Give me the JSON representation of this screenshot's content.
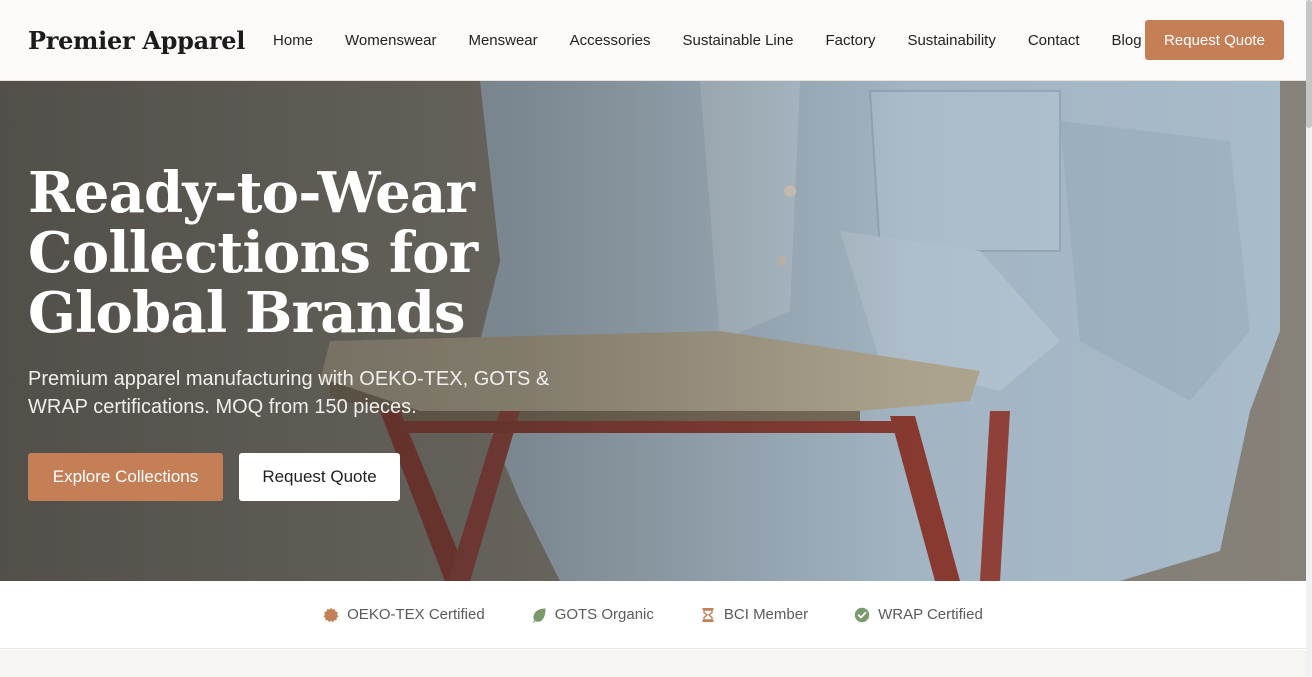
{
  "header": {
    "logo": "Premier Apparel",
    "nav": [
      {
        "label": "Home"
      },
      {
        "label": "Womenswear"
      },
      {
        "label": "Menswear"
      },
      {
        "label": "Accessories"
      },
      {
        "label": "Sustainable Line"
      },
      {
        "label": "Factory"
      },
      {
        "label": "Sustainability"
      },
      {
        "label": "Contact"
      },
      {
        "label": "Blog"
      }
    ],
    "cta_label": "Request Quote"
  },
  "hero": {
    "title": "Ready-to-Wear Collections for Global Brands",
    "subtitle": "Premium apparel manufacturing with OEKO-TEX, GOTS & WRAP certifications. MOQ from 150 pieces.",
    "primary_button": "Explore Collections",
    "secondary_button": "Request Quote"
  },
  "certifications": [
    {
      "label": "OEKO-TEX Certified",
      "icon": "badge-icon",
      "color": "#c47f57"
    },
    {
      "label": "GOTS Organic",
      "icon": "leaf-icon",
      "color": "#7a9a6e"
    },
    {
      "label": "BCI Member",
      "icon": "hourglass-icon",
      "color": "#c47f57"
    },
    {
      "label": "WRAP Certified",
      "icon": "check-circle-icon",
      "color": "#7a9a6e"
    }
  ],
  "colors": {
    "accent": "#c47f57",
    "header_bg": "#fbfaf8"
  }
}
